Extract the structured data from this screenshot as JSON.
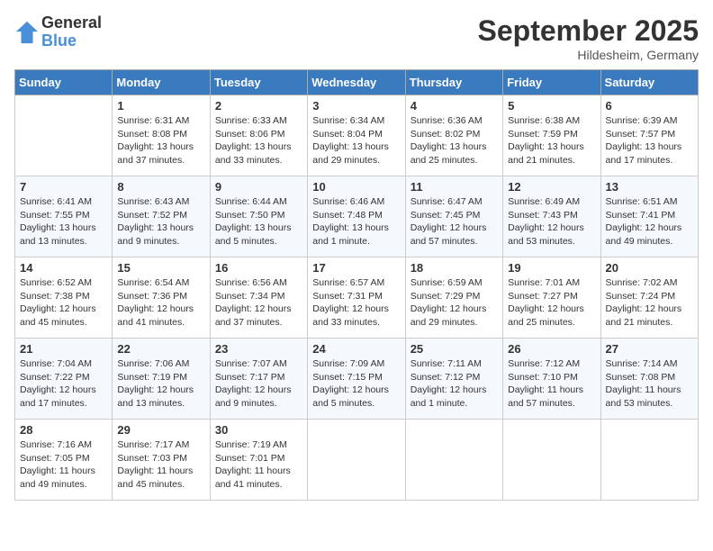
{
  "logo": {
    "general": "General",
    "blue": "Blue"
  },
  "header": {
    "month": "September 2025",
    "location": "Hildesheim, Germany"
  },
  "columns": [
    "Sunday",
    "Monday",
    "Tuesday",
    "Wednesday",
    "Thursday",
    "Friday",
    "Saturday"
  ],
  "weeks": [
    [
      {
        "day": "",
        "sunrise": "",
        "sunset": "",
        "daylight": ""
      },
      {
        "day": "1",
        "sunrise": "Sunrise: 6:31 AM",
        "sunset": "Sunset: 8:08 PM",
        "daylight": "Daylight: 13 hours and 37 minutes."
      },
      {
        "day": "2",
        "sunrise": "Sunrise: 6:33 AM",
        "sunset": "Sunset: 8:06 PM",
        "daylight": "Daylight: 13 hours and 33 minutes."
      },
      {
        "day": "3",
        "sunrise": "Sunrise: 6:34 AM",
        "sunset": "Sunset: 8:04 PM",
        "daylight": "Daylight: 13 hours and 29 minutes."
      },
      {
        "day": "4",
        "sunrise": "Sunrise: 6:36 AM",
        "sunset": "Sunset: 8:02 PM",
        "daylight": "Daylight: 13 hours and 25 minutes."
      },
      {
        "day": "5",
        "sunrise": "Sunrise: 6:38 AM",
        "sunset": "Sunset: 7:59 PM",
        "daylight": "Daylight: 13 hours and 21 minutes."
      },
      {
        "day": "6",
        "sunrise": "Sunrise: 6:39 AM",
        "sunset": "Sunset: 7:57 PM",
        "daylight": "Daylight: 13 hours and 17 minutes."
      }
    ],
    [
      {
        "day": "7",
        "sunrise": "Sunrise: 6:41 AM",
        "sunset": "Sunset: 7:55 PM",
        "daylight": "Daylight: 13 hours and 13 minutes."
      },
      {
        "day": "8",
        "sunrise": "Sunrise: 6:43 AM",
        "sunset": "Sunset: 7:52 PM",
        "daylight": "Daylight: 13 hours and 9 minutes."
      },
      {
        "day": "9",
        "sunrise": "Sunrise: 6:44 AM",
        "sunset": "Sunset: 7:50 PM",
        "daylight": "Daylight: 13 hours and 5 minutes."
      },
      {
        "day": "10",
        "sunrise": "Sunrise: 6:46 AM",
        "sunset": "Sunset: 7:48 PM",
        "daylight": "Daylight: 13 hours and 1 minute."
      },
      {
        "day": "11",
        "sunrise": "Sunrise: 6:47 AM",
        "sunset": "Sunset: 7:45 PM",
        "daylight": "Daylight: 12 hours and 57 minutes."
      },
      {
        "day": "12",
        "sunrise": "Sunrise: 6:49 AM",
        "sunset": "Sunset: 7:43 PM",
        "daylight": "Daylight: 12 hours and 53 minutes."
      },
      {
        "day": "13",
        "sunrise": "Sunrise: 6:51 AM",
        "sunset": "Sunset: 7:41 PM",
        "daylight": "Daylight: 12 hours and 49 minutes."
      }
    ],
    [
      {
        "day": "14",
        "sunrise": "Sunrise: 6:52 AM",
        "sunset": "Sunset: 7:38 PM",
        "daylight": "Daylight: 12 hours and 45 minutes."
      },
      {
        "day": "15",
        "sunrise": "Sunrise: 6:54 AM",
        "sunset": "Sunset: 7:36 PM",
        "daylight": "Daylight: 12 hours and 41 minutes."
      },
      {
        "day": "16",
        "sunrise": "Sunrise: 6:56 AM",
        "sunset": "Sunset: 7:34 PM",
        "daylight": "Daylight: 12 hours and 37 minutes."
      },
      {
        "day": "17",
        "sunrise": "Sunrise: 6:57 AM",
        "sunset": "Sunset: 7:31 PM",
        "daylight": "Daylight: 12 hours and 33 minutes."
      },
      {
        "day": "18",
        "sunrise": "Sunrise: 6:59 AM",
        "sunset": "Sunset: 7:29 PM",
        "daylight": "Daylight: 12 hours and 29 minutes."
      },
      {
        "day": "19",
        "sunrise": "Sunrise: 7:01 AM",
        "sunset": "Sunset: 7:27 PM",
        "daylight": "Daylight: 12 hours and 25 minutes."
      },
      {
        "day": "20",
        "sunrise": "Sunrise: 7:02 AM",
        "sunset": "Sunset: 7:24 PM",
        "daylight": "Daylight: 12 hours and 21 minutes."
      }
    ],
    [
      {
        "day": "21",
        "sunrise": "Sunrise: 7:04 AM",
        "sunset": "Sunset: 7:22 PM",
        "daylight": "Daylight: 12 hours and 17 minutes."
      },
      {
        "day": "22",
        "sunrise": "Sunrise: 7:06 AM",
        "sunset": "Sunset: 7:19 PM",
        "daylight": "Daylight: 12 hours and 13 minutes."
      },
      {
        "day": "23",
        "sunrise": "Sunrise: 7:07 AM",
        "sunset": "Sunset: 7:17 PM",
        "daylight": "Daylight: 12 hours and 9 minutes."
      },
      {
        "day": "24",
        "sunrise": "Sunrise: 7:09 AM",
        "sunset": "Sunset: 7:15 PM",
        "daylight": "Daylight: 12 hours and 5 minutes."
      },
      {
        "day": "25",
        "sunrise": "Sunrise: 7:11 AM",
        "sunset": "Sunset: 7:12 PM",
        "daylight": "Daylight: 12 hours and 1 minute."
      },
      {
        "day": "26",
        "sunrise": "Sunrise: 7:12 AM",
        "sunset": "Sunset: 7:10 PM",
        "daylight": "Daylight: 11 hours and 57 minutes."
      },
      {
        "day": "27",
        "sunrise": "Sunrise: 7:14 AM",
        "sunset": "Sunset: 7:08 PM",
        "daylight": "Daylight: 11 hours and 53 minutes."
      }
    ],
    [
      {
        "day": "28",
        "sunrise": "Sunrise: 7:16 AM",
        "sunset": "Sunset: 7:05 PM",
        "daylight": "Daylight: 11 hours and 49 minutes."
      },
      {
        "day": "29",
        "sunrise": "Sunrise: 7:17 AM",
        "sunset": "Sunset: 7:03 PM",
        "daylight": "Daylight: 11 hours and 45 minutes."
      },
      {
        "day": "30",
        "sunrise": "Sunrise: 7:19 AM",
        "sunset": "Sunset: 7:01 PM",
        "daylight": "Daylight: 11 hours and 41 minutes."
      },
      {
        "day": "",
        "sunrise": "",
        "sunset": "",
        "daylight": ""
      },
      {
        "day": "",
        "sunrise": "",
        "sunset": "",
        "daylight": ""
      },
      {
        "day": "",
        "sunrise": "",
        "sunset": "",
        "daylight": ""
      },
      {
        "day": "",
        "sunrise": "",
        "sunset": "",
        "daylight": ""
      }
    ]
  ]
}
